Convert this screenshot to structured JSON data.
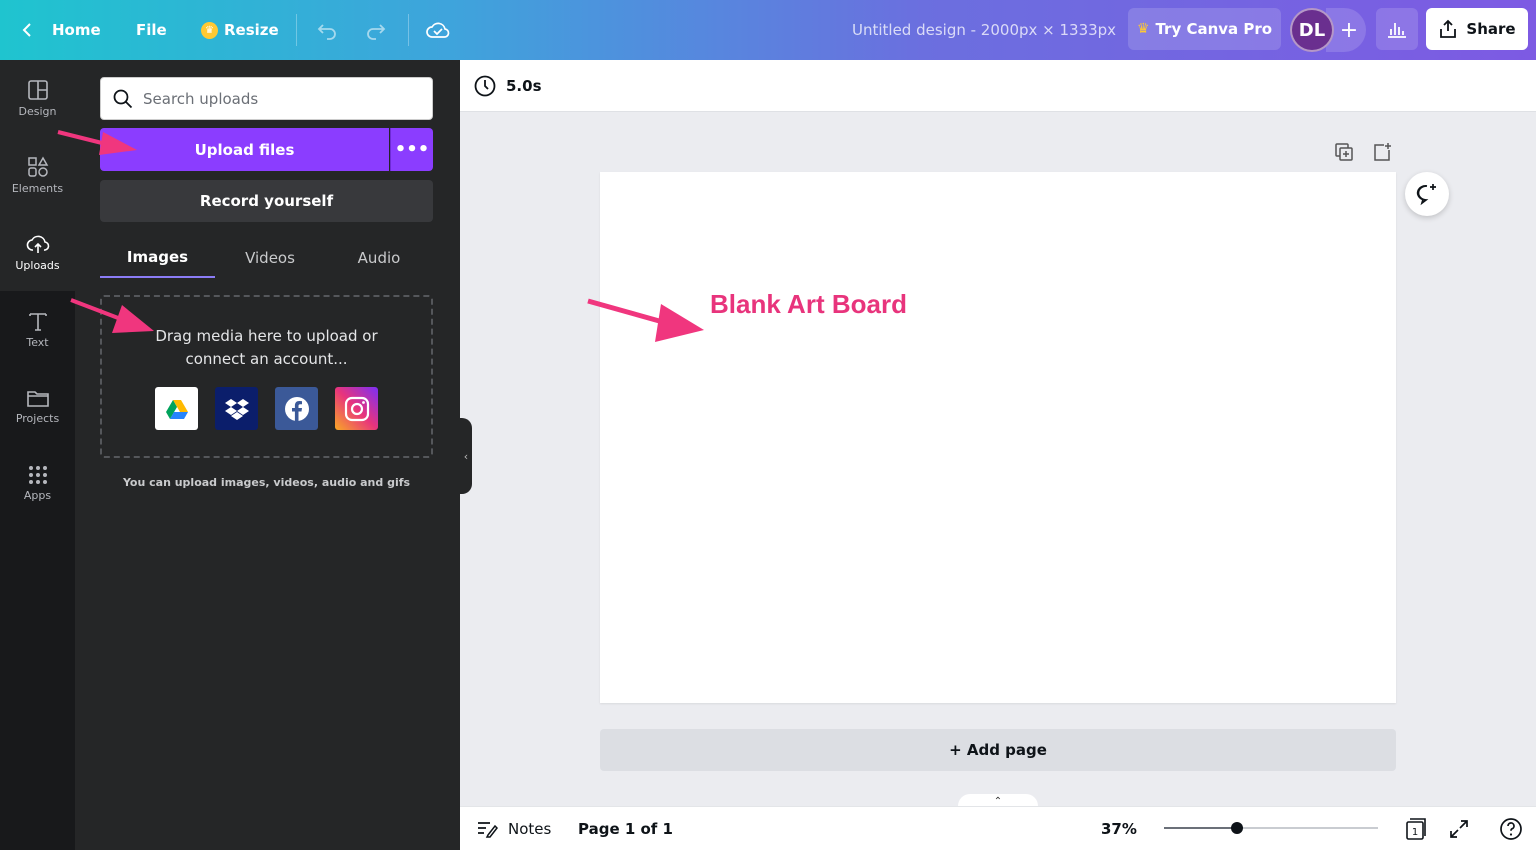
{
  "topbar": {
    "home": "Home",
    "file": "File",
    "resize": "Resize",
    "design_title": "Untitled design - 2000px × 1333px",
    "try_pro": "Try Canva Pro",
    "avatar_initials": "DL",
    "share": "Share"
  },
  "rail": {
    "items": [
      {
        "label": "Design",
        "icon": "design-icon"
      },
      {
        "label": "Elements",
        "icon": "elements-icon"
      },
      {
        "label": "Uploads",
        "icon": "cloud-upload-icon"
      },
      {
        "label": "Text",
        "icon": "text-icon"
      },
      {
        "label": "Projects",
        "icon": "folder-icon"
      },
      {
        "label": "Apps",
        "icon": "apps-grid-icon"
      }
    ],
    "active": "Uploads"
  },
  "panel": {
    "search_placeholder": "Search uploads",
    "upload_files": "Upload files",
    "upload_more": "•••",
    "record_yourself": "Record yourself",
    "tabs": [
      "Images",
      "Videos",
      "Audio"
    ],
    "active_tab": "Images",
    "drop_line1": "Drag media here to upload or",
    "drop_line2": "connect an account...",
    "services": [
      "google-drive-icon",
      "dropbox-icon",
      "facebook-icon",
      "instagram-icon"
    ],
    "upload_note": "You can upload images, videos, audio and gifs"
  },
  "canvas": {
    "duration": "5.0s",
    "annotation": "Blank Art Board",
    "add_page": "+ Add page"
  },
  "bottombar": {
    "notes": "Notes",
    "page_indicator": "Page 1 of 1",
    "zoom": "37%",
    "zoom_fraction": 0.34,
    "page_count": "1"
  },
  "colors": {
    "accent": "#8b3dff",
    "annotation": "#e8347c",
    "panel_bg": "#252627",
    "rail_bg": "#18191b"
  }
}
